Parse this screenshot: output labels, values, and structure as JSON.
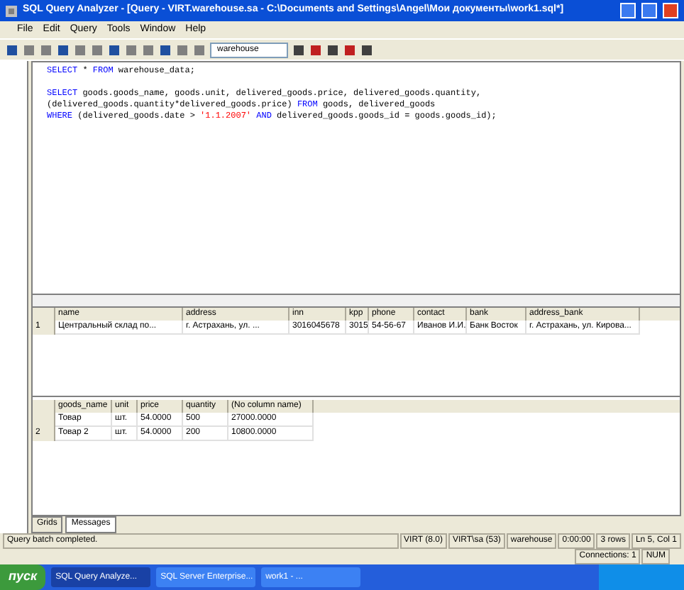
{
  "window": {
    "title": "SQL Query Analyzer - [Query - VIRT.warehouse.sa - C:\\Documents and Settings\\Angel\\Мои документы\\work1.sql*]"
  },
  "menu": [
    "File",
    "Edit",
    "Query",
    "Tools",
    "Window",
    "Help"
  ],
  "toolbar": {
    "database": "warehouse"
  },
  "editor": {
    "statements": [
      [
        [
          {
            "kind": "keyword",
            "text": "SELECT"
          },
          {
            "kind": "text",
            "text": " * "
          },
          {
            "kind": "keyword",
            "text": "FROM"
          },
          {
            "kind": "text",
            "text": " warehouse_data;"
          }
        ]
      ],
      [
        [
          {
            "kind": "keyword",
            "text": "SELECT"
          },
          {
            "kind": "text",
            "text": " goods.goods_name, goods.unit, delivered_goods.price, delivered_goods.quantity,"
          }
        ],
        [
          {
            "kind": "text",
            "text": "(delivered_goods.quantity*delivered_goods.price) "
          },
          {
            "kind": "keyword",
            "text": "FROM"
          },
          {
            "kind": "text",
            "text": " goods, delivered_goods"
          }
        ],
        [
          {
            "kind": "keyword",
            "text": "WHERE"
          },
          {
            "kind": "text",
            "text": " (delivered_goods.date > "
          },
          {
            "kind": "string",
            "text": "'1.1.2007'"
          },
          {
            "kind": "keyword",
            "text": " AND"
          },
          {
            "kind": "text",
            "text": " delivered_goods.goods_id = goods.goods_id);"
          }
        ]
      ]
    ]
  },
  "grid_1": {
    "columns": [
      "name",
      "address",
      "inn",
      "kpp",
      "phone",
      "contact",
      "bank",
      "address_bank"
    ],
    "rows": [
      {
        "number": "1",
        "cells": [
          "Центральный склад по...",
          "г. Астрахань, ул. ...",
          "3016045678",
          "3015",
          "54-56-67",
          "Иванов И.И.",
          "Банк Восток",
          "г. Астрахань, ул. Кирова..."
        ]
      }
    ]
  },
  "grid_2": {
    "columns": [
      "goods_name",
      "unit",
      "price",
      "quantity",
      "(No column name)"
    ],
    "rows": [
      {
        "number": "",
        "cells": [
          "Товар",
          "шт.",
          "54.0000",
          "500",
          "27000.0000"
        ]
      },
      {
        "number": "2",
        "cells": [
          "Товар 2",
          "шт.",
          "54.0000",
          "200",
          "10800.0000"
        ]
      }
    ]
  },
  "tabs": [
    {
      "label": "Grids",
      "selected": false
    },
    {
      "label": "Messages",
      "selected": true
    }
  ],
  "status_bar": [
    "Query batch completed.",
    "VIRT (8.0)",
    "VIRT\\sa (53)",
    "warehouse",
    "0:00:00",
    "3 rows",
    "Ln 5, Col 1"
  ],
  "status_bar_2": [
    "Connections: 1",
    "NUM"
  ],
  "taskbar": {
    "start": "пуск",
    "tasks": [
      {
        "label": "SQL Query Analyze...",
        "selected": true
      },
      {
        "label": "SQL Server Enterprise...",
        "selected": false
      },
      {
        "label": "work1 - ...",
        "selected": false
      }
    ]
  }
}
